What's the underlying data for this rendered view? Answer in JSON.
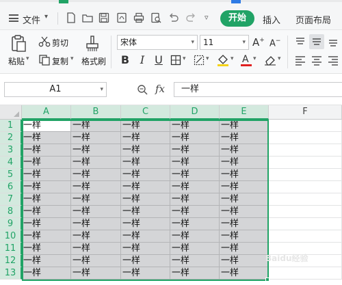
{
  "menubar": {
    "file_label": "文件",
    "tabs": {
      "start": "开始",
      "insert": "插入",
      "page_layout": "页面布局"
    },
    "quick_access_icons": [
      "new-doc-icon",
      "open-folder-icon",
      "save-icon",
      "export-pdf-icon",
      "print-icon",
      "print-preview-icon",
      "undo-icon",
      "redo-icon",
      "customize-chevron-icon"
    ]
  },
  "ribbon": {
    "paste_label": "粘贴",
    "cut_label": "剪切",
    "copy_label": "复制",
    "format_painter_label": "格式刷",
    "font_name": "宋体",
    "font_size": "11",
    "bold": "B",
    "italic": "I",
    "underline": "U",
    "increase_font": "A⁺",
    "decrease_font": "A⁻",
    "font_color_accent": "#e02020",
    "fill_color_accent": "#f5d318"
  },
  "formula_bar": {
    "name_box": "A1",
    "fx": "fx",
    "formula_value": "一样"
  },
  "sheet": {
    "columns": [
      "A",
      "B",
      "C",
      "D",
      "E",
      "F"
    ],
    "rows": [
      "1",
      "2",
      "3",
      "4",
      "5",
      "6",
      "7",
      "8",
      "9",
      "10",
      "11",
      "12",
      "13"
    ],
    "cell_text": "一样",
    "selection": "A1:E13",
    "accent": "#21a366",
    "selected_fill": "#d4d5d7"
  },
  "watermark": "Baidu经验"
}
